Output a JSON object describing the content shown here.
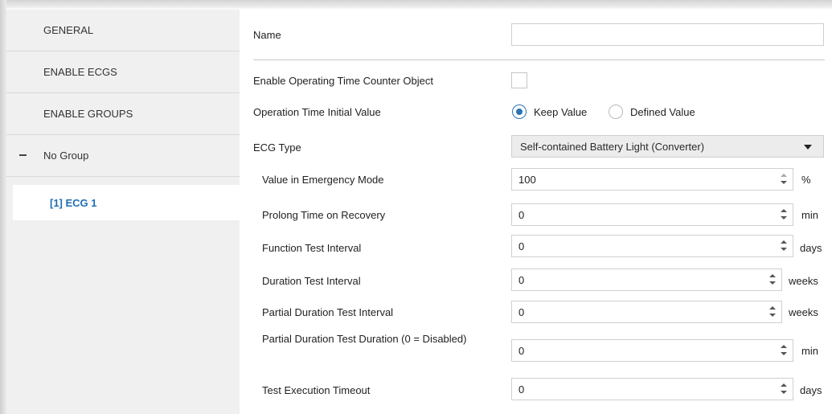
{
  "sidebar": {
    "items": [
      {
        "label": "GENERAL"
      },
      {
        "label": "ENABLE ECGS"
      },
      {
        "label": "ENABLE GROUPS"
      },
      {
        "label": "No Group"
      },
      {
        "label": "[1] ECG 1"
      }
    ]
  },
  "main": {
    "name_label": "Name",
    "name_value": "",
    "operating_counter_label": "Enable Operating Time Counter Object",
    "operating_counter_checked": false,
    "initial_value_label": "Operation Time Initial Value",
    "initial_value_options": [
      "Keep Value",
      "Defined Value"
    ],
    "initial_value_selected": "Keep Value",
    "ecg_type_label": "ECG Type",
    "ecg_type_value": "Self-contained Battery Light (Converter)",
    "fields": [
      {
        "label": "Value in Emergency Mode",
        "value": "100",
        "unit": "%"
      },
      {
        "label": "Prolong Time on Recovery",
        "value": "0",
        "unit": "min"
      },
      {
        "label": "Function Test Interval",
        "value": "0",
        "unit": "days"
      },
      {
        "label": "Duration Test Interval",
        "value": "0",
        "unit": "weeks"
      },
      {
        "label": "Partial Duration Test Interval",
        "value": "0",
        "unit": "weeks"
      },
      {
        "label": "Partial Duration Test Duration (0 = Disabled)",
        "value": "0",
        "unit": "min"
      },
      {
        "label": "Test Execution Timeout",
        "value": "0",
        "unit": "days"
      }
    ]
  },
  "colors": {
    "sidebar_bg": "#f0f0f0",
    "selected_text": "#1e6fb5",
    "radio_accent": "#2c73b8"
  }
}
